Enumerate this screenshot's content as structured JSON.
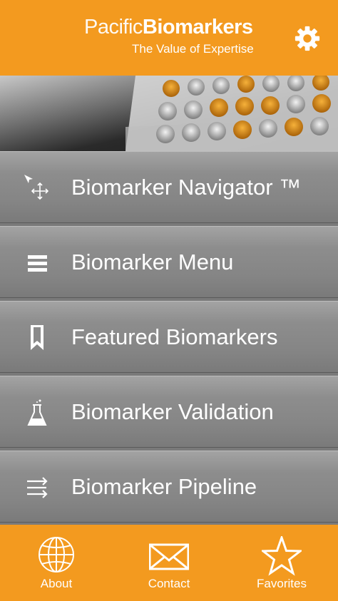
{
  "header": {
    "brand_light": "Pacific",
    "brand_bold": "Biomarkers",
    "tagline": "The Value of Expertise",
    "settings_icon": "gear-icon"
  },
  "banner": {
    "image": "laboratory well plate photo"
  },
  "menu": {
    "items": [
      {
        "label": "Biomarker Navigator ™",
        "icon": "navigator-move-icon"
      },
      {
        "label": "Biomarker Menu",
        "icon": "menu-lines-icon"
      },
      {
        "label": "Featured Biomarkers",
        "icon": "bookmark-icon"
      },
      {
        "label": "Biomarker Validation",
        "icon": "flask-icon"
      },
      {
        "label": "Biomarker Pipeline",
        "icon": "pipeline-arrows-icon"
      }
    ]
  },
  "tabbar": {
    "tabs": [
      {
        "label": "About",
        "icon": "globe-icon"
      },
      {
        "label": "Contact",
        "icon": "envelope-icon"
      },
      {
        "label": "Favorites",
        "icon": "star-icon"
      }
    ]
  },
  "colors": {
    "accent": "#f39a1f",
    "menu_gray": "#8a8a8a",
    "text": "#ffffff"
  }
}
